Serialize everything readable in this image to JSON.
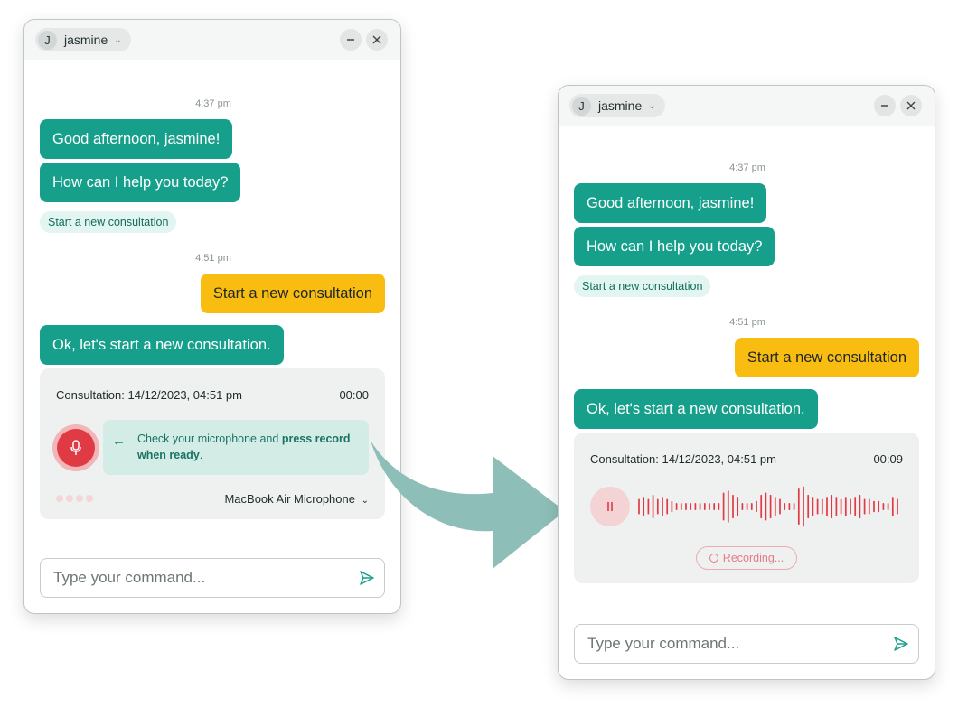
{
  "colors": {
    "bot_bubble": "#16a08c",
    "user_bubble": "#f9bd12",
    "chip_bg": "#e2f5f0",
    "record_red": "#e03a45",
    "arrow": "#8dbfb8"
  },
  "windows": [
    {
      "user": {
        "initial": "J",
        "name": "jasmine"
      },
      "controls": {
        "minimize_icon": "minus-icon",
        "close_icon": "close-icon"
      },
      "messages": [
        {
          "time": "4:37 pm"
        },
        {
          "text": "Good afternoon, jasmine!"
        },
        {
          "text": "How can I help you today?"
        },
        {
          "chip": "Start a new consultation"
        },
        {
          "time": "4:51 pm"
        },
        {
          "text": "Start a new consultation"
        },
        {
          "text": "Ok, let's start a new consultation."
        }
      ],
      "consultation": {
        "title": "Consultation: 14/12/2023, 04:51 pm",
        "timer": "00:00",
        "hint_prefix": "Check your microphone and ",
        "hint_bold": "press record when ready",
        "hint_suffix": ".",
        "microphone": "MacBook Air Microphone"
      },
      "input": {
        "placeholder": "Type your command..."
      }
    },
    {
      "user": {
        "initial": "J",
        "name": "jasmine"
      },
      "controls": {
        "minimize_icon": "minus-icon",
        "close_icon": "close-icon"
      },
      "messages": [
        {
          "time": "4:37 pm"
        },
        {
          "text": "Good afternoon, jasmine!"
        },
        {
          "text": "How can I help you today?"
        },
        {
          "chip": "Start a new consultation"
        },
        {
          "time": "4:51 pm"
        },
        {
          "text": "Start a new consultation"
        },
        {
          "text": "Ok, let's start a new consultation."
        }
      ],
      "consultation": {
        "title": "Consultation: 14/12/2023, 04:51 pm",
        "timer": "00:09",
        "status": "Recording..."
      },
      "input": {
        "placeholder": "Type your command..."
      }
    }
  ]
}
